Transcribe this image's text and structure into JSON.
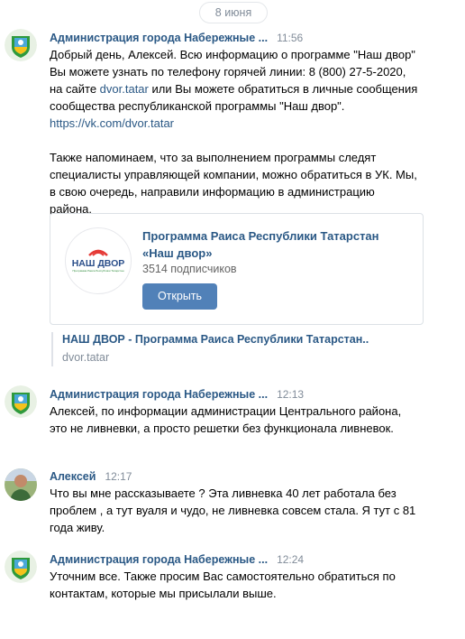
{
  "date_separator": "8 июня",
  "messages": [
    {
      "author": "Администрация города Набережные ...",
      "time": "11:56",
      "text_p1a": "Добрый день, Алексей. Всю информацию о программе \"Наш двор\" Вы можете узнать по телефону горячей линии: 8 (800) 27-5-2020, на сайте ",
      "link1": "dvor.tatar",
      "text_p1b": " или Вы можете обратиться в личные сообщения сообщества республиканской программы \"Наш двор\".",
      "link2": "https://vk.com/dvor.tatar",
      "text_p2": "Также напоминаем, что за выполнением программы следят специалисты управляющей компании, можно обратиться в УК. Мы, в свою очередь, направили информацию в администрацию района."
    },
    {
      "author": "Администрация города Набережные ...",
      "time": "12:13",
      "text": "Алексей, по информации администрации Центрального района, это не ливневки, а просто решетки без функционала ливневок."
    },
    {
      "author": "Алексей",
      "time": "12:17",
      "text": "Что вы мне рассказываете ? Эта ливневка 40 лет работала без проблем , а тут вуаля и чудо, не ливневка совсем стала. Я тут с 81 года живу."
    },
    {
      "author": "Администрация города Набережные ...",
      "time": "12:24",
      "text": "Уточним все. Также просим Вас самостоятельно обратиться по контактам, которые мы присылали выше."
    }
  ],
  "group_card": {
    "title": "Программа Раиса Республики Татарстан «Наш двор»",
    "subscribers": "3514 подписчиков",
    "button": "Открыть",
    "logo_text": "НАШ ДВОР",
    "logo_subtext": "Программа Раиса Республики Татарстан"
  },
  "link_preview": {
    "title": "НАШ ДВОР - Программа Раиса Республики Татарстан..",
    "site": "dvor.tatar"
  },
  "colors": {
    "link": "#2a5885",
    "time": "#818c99",
    "button": "#5181b8"
  }
}
